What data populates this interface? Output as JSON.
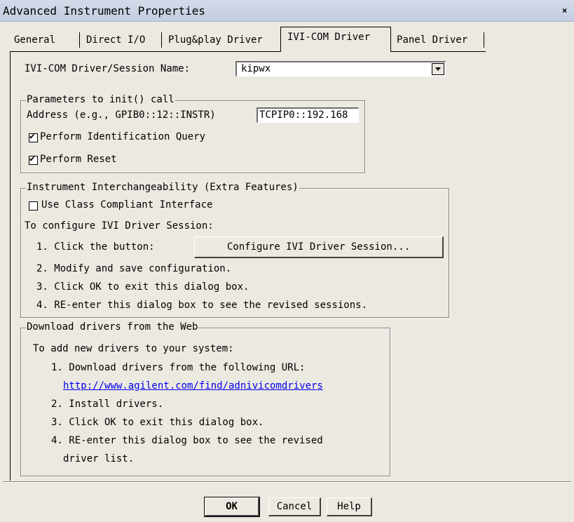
{
  "window": {
    "title": "Advanced Instrument Properties",
    "close_label": "×"
  },
  "tabs": [
    {
      "label": "General"
    },
    {
      "label": "Direct I/O"
    },
    {
      "label": "Plug&play Driver"
    },
    {
      "label": "IVI-COM Driver"
    },
    {
      "label": "Panel Driver"
    }
  ],
  "session": {
    "label": "IVI-COM Driver/Session Name:",
    "value": "kipwx"
  },
  "init_group": {
    "legend": "Parameters to init() call",
    "address_label": "Address (e.g., GPIB0::12::INSTR)",
    "address_value": "TCPIP0::192.168",
    "id_query_label": "Perform Identification Query",
    "id_query_checked": true,
    "reset_label": "Perform Reset",
    "reset_checked": true,
    "check_mark": "✔"
  },
  "interchange_group": {
    "legend": "Instrument Interchangeability (Extra Features)",
    "class_compliant_label": "Use Class Compliant Interface",
    "class_compliant_checked": false,
    "configure_heading": "To configure IVI Driver Session:",
    "step1": "1. Click the button:",
    "configure_button": "Configure IVI Driver Session...",
    "step2": "2. Modify and save configuration.",
    "step3": "3. Click OK to exit this dialog box.",
    "step4": "4. RE-enter this dialog box to see the revised sessions."
  },
  "download_group": {
    "legend": "Download drivers from the Web",
    "heading": "To add new drivers to your system:",
    "step1": "1. Download drivers from the following URL:",
    "url": "http://www.agilent.com/find/adnivicomdrivers",
    "step2": "2. Install drivers.",
    "step3": "3. Click OK to exit this dialog box.",
    "step4_line1": "4. RE-enter this dialog box to see the revised",
    "step4_line2": "driver list."
  },
  "footer": {
    "ok_label": "OK",
    "cancel_label": "Cancel",
    "help_label": "Help"
  }
}
